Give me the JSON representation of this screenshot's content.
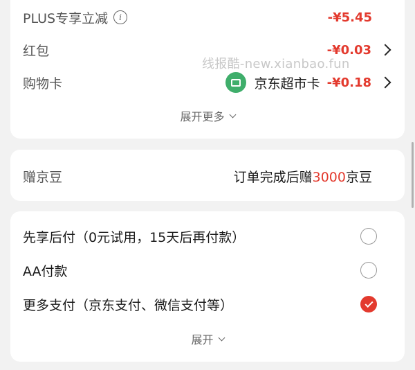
{
  "discounts": {
    "plus": {
      "label": "PLUS专享立减",
      "amount": "-¥5.45",
      "info_icon": "info-icon"
    },
    "red_packet": {
      "label": "红包",
      "amount": "-¥0.03"
    },
    "shopping_card": {
      "label": "购物卡",
      "card_name": "京东超市卡",
      "amount": "-¥0.18"
    },
    "expand_more_label": "展开更多"
  },
  "watermark": "线报酷-new.xianbao.fun",
  "bean": {
    "label": "赠京豆",
    "prefix": "订单完成后赠",
    "count": "3000",
    "suffix": "京豆"
  },
  "payment": {
    "options": [
      {
        "label": "先享后付（0元试用，15天后再付款）",
        "selected": false
      },
      {
        "label": "AA付款",
        "selected": false
      },
      {
        "label": "更多支付（京东支付、微信支付等）",
        "selected": true
      }
    ],
    "expand_label": "展开"
  },
  "colors": {
    "accent": "#e33a2e",
    "card_icon": "#3fae6b",
    "background": "#f2f2f2"
  }
}
